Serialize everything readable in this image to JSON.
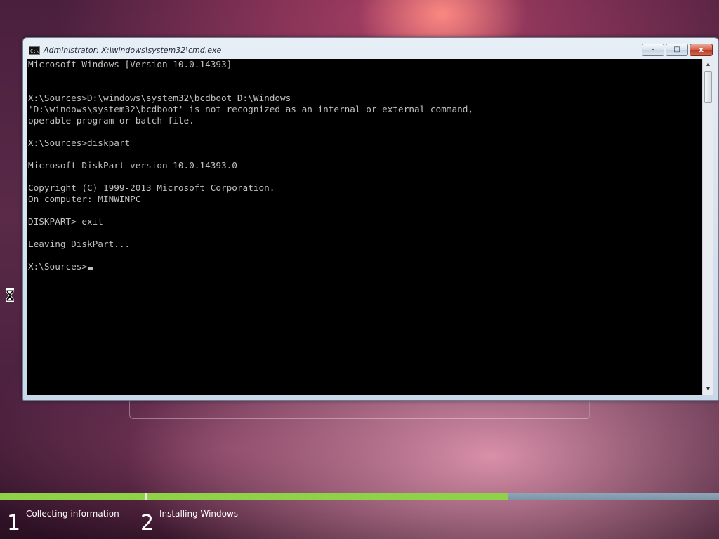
{
  "window": {
    "title": "Administrator: X:\\windows\\system32\\cmd.exe",
    "icon_text": "C:\\"
  },
  "window_controls": {
    "minimize_glyph": "–",
    "maximize_glyph": "□",
    "close_glyph": "x"
  },
  "console": {
    "lines": [
      "Microsoft Windows [Version 10.0.14393]",
      "",
      "",
      "X:\\Sources>D:\\windows\\system32\\bcdboot D:\\Windows",
      "'D:\\windows\\system32\\bcdboot' is not recognized as an internal or external command,",
      "operable program or batch file.",
      "",
      "X:\\Sources>diskpart",
      "",
      "Microsoft DiskPart version 10.0.14393.0",
      "",
      "Copyright (C) 1999-2013 Microsoft Corporation.",
      "On computer: MINWINPC",
      "",
      "DISKPART> exit",
      "",
      "Leaving DiskPart...",
      "",
      "X:\\Sources>"
    ]
  },
  "scrollbar": {
    "up_glyph": "▴",
    "down_glyph": "▾"
  },
  "setup": {
    "steps": [
      {
        "number": "1",
        "label": "Collecting information"
      },
      {
        "number": "2",
        "label": "Installing Windows"
      }
    ],
    "step_1_progress": 1.0,
    "step_2_progress": 0.63,
    "progress_color": "#8fd24a",
    "track_color": "#7b93a6"
  },
  "colors": {
    "console_bg": "#000000",
    "console_fg": "#c0c0c0",
    "close_button": "#c9452f"
  }
}
